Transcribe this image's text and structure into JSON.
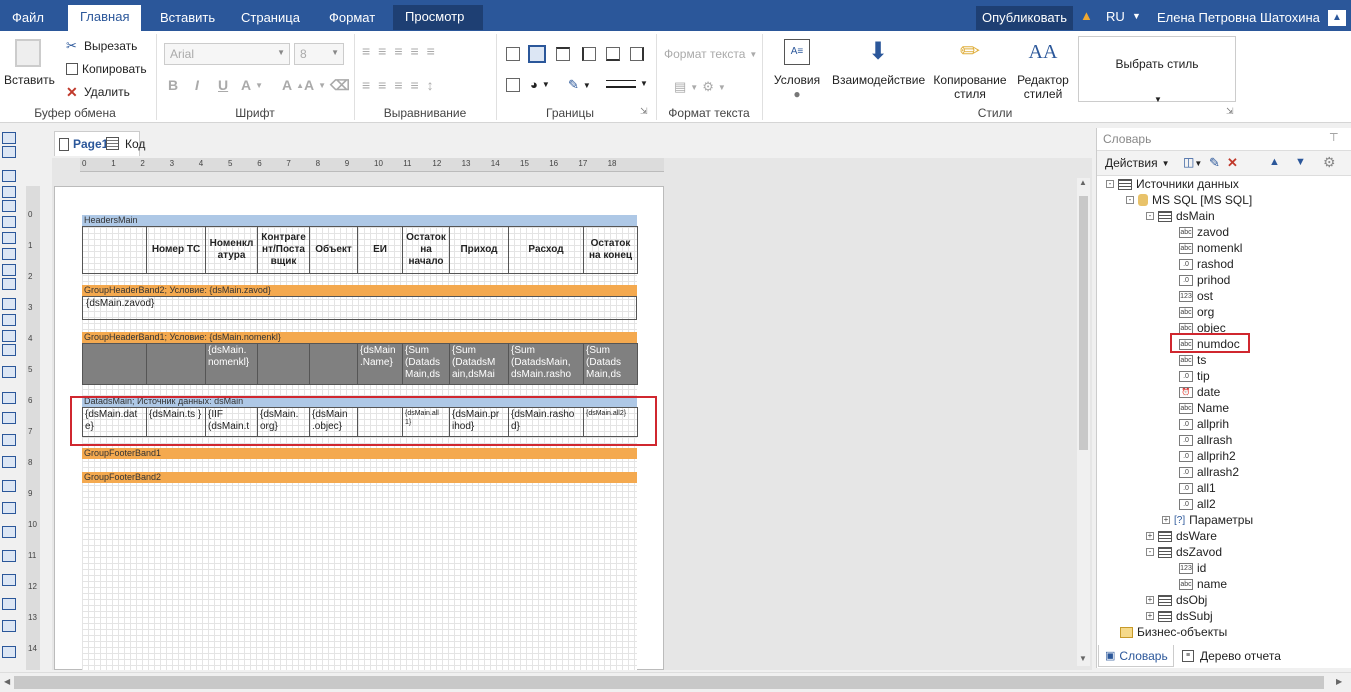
{
  "menu": {
    "tabs": [
      "Файл",
      "Главная",
      "Вставить",
      "Страница",
      "Формат",
      "Просмотр"
    ],
    "publish": "Опубликовать",
    "lang": "RU",
    "user": "Елена Петровна Шатохина"
  },
  "ribbon": {
    "clipboard": {
      "paste": "Вставить",
      "cut": "Вырезать",
      "copy": "Копировать",
      "delete": "Удалить",
      "label": "Буфер обмена"
    },
    "font": {
      "family": "Arial",
      "size": "8",
      "label": "Шрифт"
    },
    "align": {
      "label": "Выравнивание"
    },
    "borders": {
      "label": "Границы"
    },
    "text_format": {
      "combo": "Формат текста",
      "label": "Формат текста"
    },
    "styles": {
      "conditions": "Условия",
      "interaction": "Взаимодействие",
      "copy_style_1": "Копирование",
      "copy_style_2": "стиля",
      "editor_1": "Редактор",
      "editor_2": "стилей",
      "choose": "Выбрать стиль",
      "label": "Стили"
    }
  },
  "doc_tabs": {
    "page": "Page1",
    "code": "Код"
  },
  "ruler": [
    "0",
    "1",
    "2",
    "3",
    "4",
    "5",
    "6",
    "7",
    "8",
    "9",
    "10",
    "11",
    "12",
    "13",
    "14",
    "15",
    "16",
    "17",
    "18"
  ],
  "ruler_left": [
    "0",
    "1",
    "2",
    "3",
    "4",
    "5",
    "6",
    "7",
    "8",
    "9",
    "10",
    "11",
    "12",
    "13",
    "14",
    "15"
  ],
  "report": {
    "header_band": "HeadersMain",
    "headers": [
      "",
      "Номер ТС",
      "Номенкл атура",
      "Контраге нт/Поста вщик",
      "Объект",
      "ЕИ",
      "Остаток на начало",
      "Приход",
      "Расход",
      "Остаток на конец"
    ],
    "group2_band": "GroupHeaderBand2; Условие: {dsMain.zavod}",
    "group2_text": "{dsMain.zavod}",
    "group1_band": "GroupHeaderBand1; Условие: {dsMain.nomenkl}",
    "group1_cells": [
      "",
      "",
      "{dsMain. nomenkl}",
      "",
      "",
      "{dsMain .Name}",
      "{Sum (Datads Main,ds",
      "{Sum (DatadsM ain,dsMai",
      "{Sum (DatadsMain, dsMain.rasho",
      "{Sum (Datads Main,ds"
    ],
    "data_band": "DatadsMain; Источник данных: dsMain",
    "data_cells": [
      "{dsMain.dat e}",
      "{dsMain.ts }",
      "{IIF (dsMain.t",
      "{dsMain. org}",
      "{dsMain .objec}",
      "",
      "{dsMain.all 1}",
      "{dsMain.pr ihod}",
      "{dsMain.rasho d}",
      "{dsMain.all2}"
    ],
    "footer1": "GroupFooterBand1",
    "footer2": "GroupFooterBand2"
  },
  "dictionary": {
    "title": "Словарь",
    "actions": "Действия",
    "sources": "Источники данных",
    "connection": "MS SQL [MS SQL]",
    "ds_main": "dsMain",
    "fields": [
      {
        "name": "zavod",
        "type": "abc"
      },
      {
        "name": "nomenkl",
        "type": "abc"
      },
      {
        "name": "rashod",
        "type": ".0"
      },
      {
        "name": "prihod",
        "type": ".0"
      },
      {
        "name": "ost",
        "type": "123"
      },
      {
        "name": "org",
        "type": "abc"
      },
      {
        "name": "objec",
        "type": "abc"
      },
      {
        "name": "numdoc",
        "type": "abc"
      },
      {
        "name": "ts",
        "type": "abc"
      },
      {
        "name": "tip",
        "type": ".0"
      },
      {
        "name": "date",
        "type": "clock"
      },
      {
        "name": "Name",
        "type": "abc"
      },
      {
        "name": "allprih",
        "type": ".0"
      },
      {
        "name": "allrash",
        "type": ".0"
      },
      {
        "name": "allprih2",
        "type": ".0"
      },
      {
        "name": "allrash2",
        "type": ".0"
      },
      {
        "name": "all1",
        "type": ".0"
      },
      {
        "name": "all2",
        "type": ".0"
      }
    ],
    "params": "Параметры",
    "ds_ware": "dsWare",
    "ds_zavod": "dsZavod",
    "zavod_fields": [
      {
        "name": "id",
        "type": "123"
      },
      {
        "name": "name",
        "type": "abc"
      }
    ],
    "ds_obj": "dsObj",
    "ds_subj": "dsSubj",
    "business": "Бизнес-объекты",
    "tab_dict": "Словарь",
    "tab_tree": "Дерево отчета"
  },
  "colors": {
    "accent": "#2b579a",
    "band_blue": "#aec8e6",
    "band_orange": "#f4a94f",
    "highlight": "#d0272f"
  }
}
